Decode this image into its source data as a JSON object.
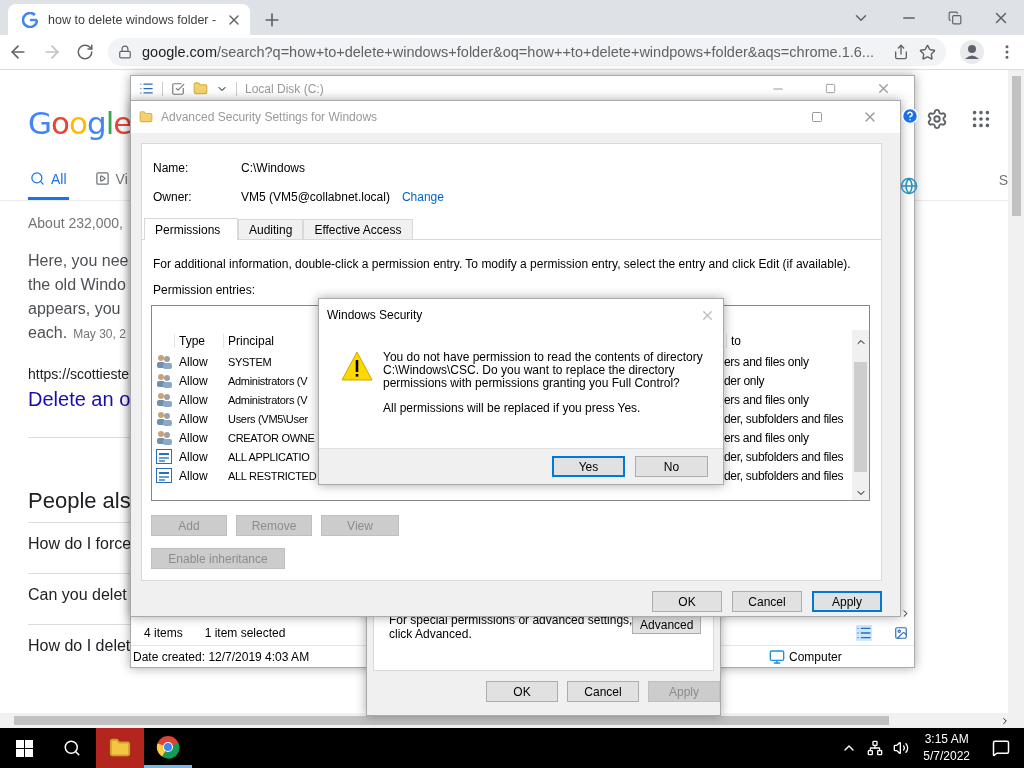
{
  "browser": {
    "tab_title": "how to delete windows folder -",
    "url_host": "google.com",
    "url_path": "/search?q=how+to+delete+windows+folder&oq=how++to+delete+windpows+folder&aqs=chrome.1.6..."
  },
  "google": {
    "logo": "Google",
    "tabs": [
      {
        "label": "All",
        "selected": true
      },
      {
        "label": "Vi",
        "selected": false
      }
    ],
    "edge_letter": "S",
    "results_count": "About 232,000,",
    "snippet_lines": [
      "Here, you nee",
      "the old Windo",
      "appears, you"
    ],
    "snippet_last": "each.",
    "snippet_date": "May 30, 2",
    "result_url": "https://scottieste",
    "result_title": "Delete an o",
    "people_also_ask": "People als",
    "questions": [
      "How do I force",
      "Can you delet",
      "How do I delet"
    ]
  },
  "explorer": {
    "address": "Local Disk (C:)",
    "item_count": "4 items",
    "selection": "1 item selected",
    "date_created": "Date created: 12/7/2019 4:03 AM",
    "location": "Computer"
  },
  "properties": {
    "note_lines": [
      "For special permissions or advanced settings,",
      "click Advanced."
    ],
    "advanced_button": "Advanced",
    "buttons": [
      {
        "label": "OK",
        "disabled": false
      },
      {
        "label": "Cancel",
        "disabled": false
      },
      {
        "label": "Apply",
        "disabled": true
      }
    ]
  },
  "advanced": {
    "title": "Advanced Security Settings for Windows",
    "name_label": "Name:",
    "name_value": "C:\\Windows",
    "owner_label": "Owner:",
    "owner_value": "VM5 (VM5@collabnet.local)",
    "change_link": "Change",
    "tabs": [
      {
        "label": "Permissions",
        "selected": true
      },
      {
        "label": "Auditing",
        "selected": false
      },
      {
        "label": "Effective Access",
        "selected": false
      }
    ],
    "info": "For additional information, double-click a permission entry. To modify a permission entry, select the entry and click Edit (if available).",
    "entries_label": "Permission entries:",
    "columns": [
      "Type",
      "Principal",
      "to"
    ],
    "entries": [
      {
        "kind": "group",
        "type": "Allow",
        "principal": "SYSTEM",
        "applies_to": "ers and files only"
      },
      {
        "kind": "group",
        "type": "Allow",
        "principal": "Administrators (V",
        "applies_to": "der only"
      },
      {
        "kind": "group",
        "type": "Allow",
        "principal": "Administrators (V",
        "applies_to": "ers and files only"
      },
      {
        "kind": "group",
        "type": "Allow",
        "principal": "Users (VM5\\User",
        "applies_to": "der, subfolders and files"
      },
      {
        "kind": "group",
        "type": "Allow",
        "principal": "CREATOR OWNE",
        "applies_to": "ers and files only"
      },
      {
        "kind": "package",
        "type": "Allow",
        "principal": "ALL APPLICATIO",
        "applies_to": "der, subfolders and files"
      },
      {
        "kind": "package",
        "type": "Allow",
        "principal": "ALL RESTRICTED",
        "applies_to": "der, subfolders and files"
      }
    ],
    "entry_buttons": [
      {
        "label": "Add",
        "disabled": true
      },
      {
        "label": "Remove",
        "disabled": true
      },
      {
        "label": "View",
        "disabled": true
      }
    ],
    "inheritance_button": {
      "label": "Enable inheritance",
      "disabled": true
    },
    "buttons": [
      {
        "label": "OK",
        "default": false
      },
      {
        "label": "Cancel",
        "default": false
      },
      {
        "label": "Apply",
        "default": true
      }
    ]
  },
  "dialog": {
    "title": "Windows Security",
    "message": "You do not have permission to read the contents of directory C:\\Windows\\CSC. Do you want to replace the directory permissions with permissions granting you Full Control?",
    "note": "All permissions will be replaced if you press Yes.",
    "buttons": [
      {
        "label": "Yes",
        "default": true
      },
      {
        "label": "No",
        "default": false
      }
    ]
  },
  "taskbar": {
    "apps": [
      {
        "kind": "explorer",
        "active": true
      },
      {
        "kind": "chrome",
        "active": false
      }
    ],
    "time": "3:15 AM",
    "date": "5/7/2022"
  }
}
